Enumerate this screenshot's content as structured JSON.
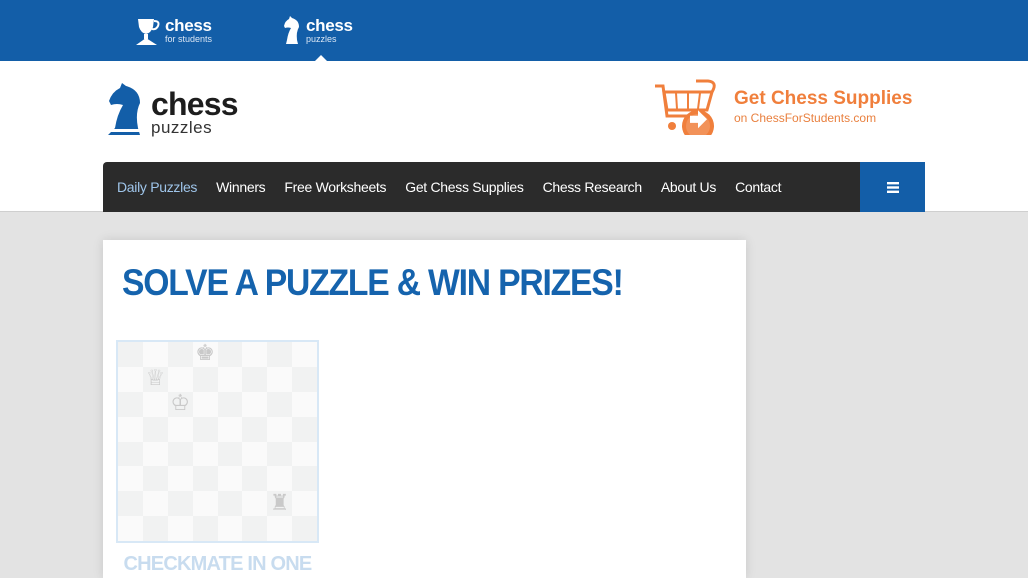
{
  "topbar": {
    "sites": [
      {
        "name": "chess",
        "sub": "for students",
        "icon": "trophy-icon"
      },
      {
        "name": "chess",
        "sub": "puzzles",
        "icon": "knight-icon"
      }
    ],
    "active_index": 1
  },
  "header": {
    "logo": {
      "word": "chess",
      "sub": "puzzles",
      "icon": "knight-icon"
    },
    "supplies": {
      "title": "Get Chess Supplies",
      "subtitle": "on ChessForStudents.com",
      "icon": "shopping-cart-icon"
    }
  },
  "nav": {
    "items": [
      {
        "label": "Daily Puzzles",
        "active": true
      },
      {
        "label": "Winners"
      },
      {
        "label": "Free Worksheets"
      },
      {
        "label": "Get Chess Supplies"
      },
      {
        "label": "Chess Research"
      },
      {
        "label": "About Us"
      },
      {
        "label": "Contact"
      }
    ],
    "menu_icon": "hamburger-menu-icon"
  },
  "main": {
    "heading": "SOLVE A PUZZLE & WIN PRIZES!",
    "puzzle": {
      "title": "CHECKMATE IN ONE",
      "pieces": [
        {
          "square": "d8",
          "glyph": "♚",
          "name": "black-king-icon"
        },
        {
          "square": "b7",
          "glyph": "♕",
          "name": "white-queen-icon"
        },
        {
          "square": "c6",
          "glyph": "♔",
          "name": "white-king-icon"
        },
        {
          "square": "g2",
          "glyph": "♜",
          "name": "black-rook-icon"
        }
      ]
    }
  },
  "colors": {
    "brand_blue": "#135ea8",
    "nav_dark": "#2b2b2b",
    "accent_orange": "#f07f3c"
  }
}
